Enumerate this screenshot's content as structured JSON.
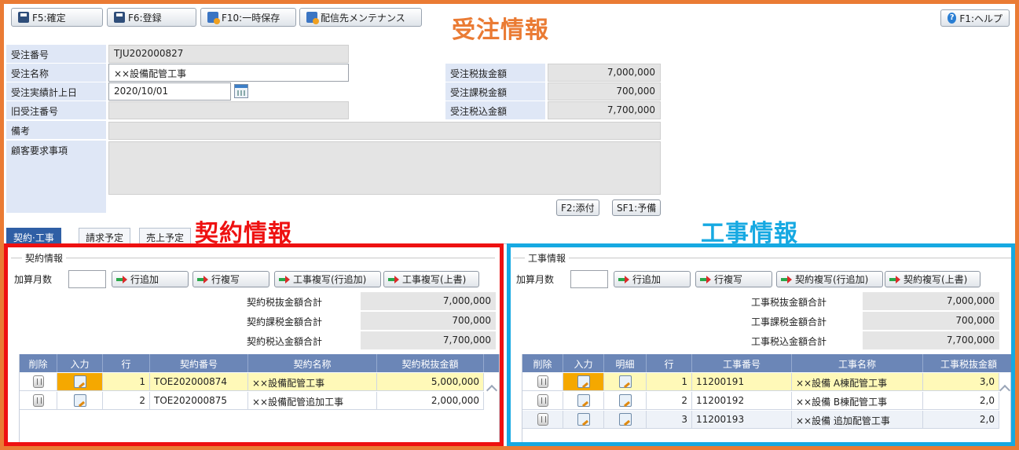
{
  "toolbar": {
    "confirm_label": "F5:確定",
    "register_label": "F6:登録",
    "temp_save_label": "F10:一時保存",
    "delivery_label": "配信先メンテナンス",
    "help_label": "F1:ヘルプ"
  },
  "annotations": {
    "order_info": "受注情報",
    "contract_info": "契約情報",
    "construction_info": "工事情報"
  },
  "colors": {
    "order_frame": "#ea7b34",
    "contract_frame": "#ee1111",
    "construction_frame": "#16a9e2",
    "row_highlight": "#fff9b8",
    "input_icon_highlight": "#f5a800"
  },
  "order": {
    "order_no_label": "受注番号",
    "order_no_value": "TJU202000827",
    "order_name_label": "受注名称",
    "order_name_value": "××設備配管工事",
    "record_date_label": "受注実績計上日",
    "record_date_value": "2020/10/01",
    "old_order_no_label": "旧受注番号",
    "old_order_no_value": "",
    "remarks_label": "備考",
    "remarks_value": "",
    "customer_req_label": "顧客要求事項",
    "customer_req_value": "",
    "pre_tax_label": "受注税抜金額",
    "pre_tax_value": "7,000,000",
    "tax_label": "受注課税金額",
    "tax_value": "700,000",
    "post_tax_label": "受注税込金額",
    "post_tax_value": "7,700,000",
    "attach_label": "F2:添付",
    "reserve_label": "SF1:予備"
  },
  "tabs": [
    "契約·工事",
    "請求予定",
    "売上予定"
  ],
  "contract": {
    "legend": "契約情報",
    "add_months_label": "加算月数",
    "add_months_value": "",
    "btn_add_row": "行追加",
    "btn_copy_row": "行複写",
    "btn_copy_construction_add": "工事複写(行追加)",
    "btn_copy_construction_overwrite": "工事複写(上書)",
    "sum_pre_tax_label": "契約税抜金額合計",
    "sum_pre_tax_value": "7,000,000",
    "sum_tax_label": "契約課税金額合計",
    "sum_tax_value": "700,000",
    "sum_post_tax_label": "契約税込金額合計",
    "sum_post_tax_value": "7,700,000",
    "columns": [
      "削除",
      "入力",
      "行",
      "契約番号",
      "契約名称",
      "契約税抜金額"
    ],
    "rows": [
      {
        "line": "1",
        "no": "TOE202000874",
        "name": "××設備配管工事",
        "amount": "5,000,000"
      },
      {
        "line": "2",
        "no": "TOE202000875",
        "name": "××設備配管追加工事",
        "amount": "2,000,000"
      }
    ]
  },
  "construction": {
    "legend": "工事情報",
    "add_months_label": "加算月数",
    "add_months_value": "",
    "btn_add_row": "行追加",
    "btn_copy_row": "行複写",
    "btn_copy_contract_add": "契約複写(行追加)",
    "btn_copy_contract_overwrite": "契約複写(上書)",
    "sum_pre_tax_label": "工事税抜金額合計",
    "sum_pre_tax_value": "7,000,000",
    "sum_tax_label": "工事課税金額合計",
    "sum_tax_value": "700,000",
    "sum_post_tax_label": "工事税込金額合計",
    "sum_post_tax_value": "7,700,000",
    "columns": [
      "削除",
      "入力",
      "明細",
      "行",
      "工事番号",
      "工事名称",
      "工事税抜金額"
    ],
    "rows": [
      {
        "line": "1",
        "no": "11200191",
        "name": "××設備 A棟配管工事",
        "amount": "3,0"
      },
      {
        "line": "2",
        "no": "11200192",
        "name": "××設備 B棟配管工事",
        "amount": "2,0"
      },
      {
        "line": "3",
        "no": "11200193",
        "name": "××設備 追加配管工事",
        "amount": "2,0"
      }
    ]
  }
}
